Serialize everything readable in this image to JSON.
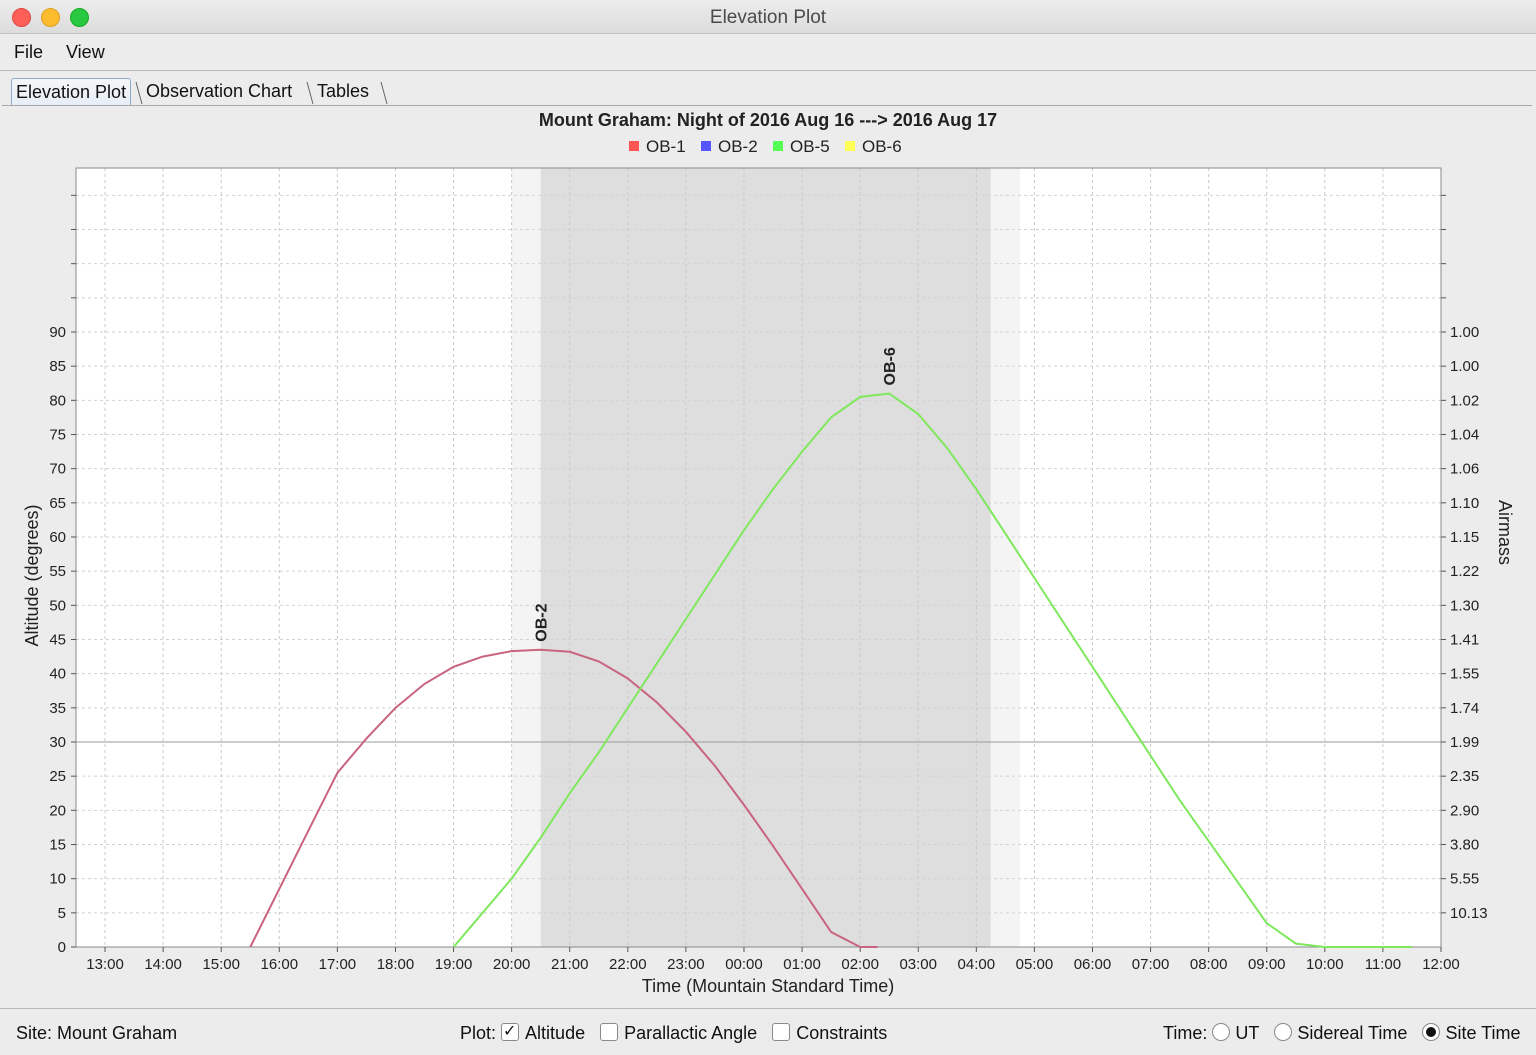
{
  "window": {
    "title": "Elevation Plot",
    "close_color": "#fc5f57",
    "minimize_color": "#fdbc2e",
    "maximize_color": "#28c840"
  },
  "menu": {
    "file": "File",
    "view": "View"
  },
  "tabs": [
    {
      "label": "Elevation Plot",
      "active": true
    },
    {
      "label": "Observation Chart",
      "active": false
    },
    {
      "label": "Tables",
      "active": false
    }
  ],
  "status": {
    "site": "Site: Mount Graham",
    "plot_label": "Plot:",
    "altitude": "Altitude",
    "altitude_checked": true,
    "parallactic": "Parallactic Angle",
    "parallactic_checked": false,
    "constraints": "Constraints",
    "constraints_checked": false,
    "time_label": "Time:",
    "ut": "UT",
    "sidereal": "Sidereal Time",
    "site_time": "Site Time",
    "selected_time": "Site Time"
  },
  "chart_data": {
    "type": "line",
    "title": "Mount Graham: Night of 2016 Aug 16 ---> 2016 Aug 17",
    "xlabel": "Time (Mountain Standard Time)",
    "ylabel": "Altitude (degrees)",
    "y2label": "Airmass",
    "x_ticks": [
      "13:00",
      "14:00",
      "15:00",
      "16:00",
      "17:00",
      "18:00",
      "19:00",
      "20:00",
      "21:00",
      "22:00",
      "23:00",
      "00:00",
      "01:00",
      "02:00",
      "03:00",
      "04:00",
      "05:00",
      "06:00",
      "07:00",
      "08:00",
      "09:00",
      "10:00",
      "11:00",
      "12:00"
    ],
    "x_range_hours": [
      12.5,
      36.0
    ],
    "ylim": [
      0,
      114
    ],
    "y_ticks": [
      0,
      5,
      10,
      15,
      20,
      25,
      30,
      35,
      40,
      45,
      50,
      55,
      60,
      65,
      70,
      75,
      80,
      85,
      90
    ],
    "airmass_ticks": [
      "10.13",
      "5.55",
      "3.80",
      "2.90",
      "2.35",
      "1.99",
      "1.74",
      "1.55",
      "1.41",
      "1.30",
      "1.22",
      "1.15",
      "1.10",
      "1.06",
      "1.04",
      "1.02",
      "1.00",
      "1.00"
    ],
    "reference_line": 30,
    "twilight_bands": [
      {
        "start": 20.0,
        "end": 20.5,
        "color": "#f4f4f4"
      },
      {
        "start": 20.5,
        "end": 28.25,
        "color": "#dedede"
      },
      {
        "start": 28.25,
        "end": 28.75,
        "color": "#f4f4f4"
      }
    ],
    "legend": [
      {
        "name": "OB-1",
        "color": "#ff5555"
      },
      {
        "name": "OB-2",
        "color": "#5555ff"
      },
      {
        "name": "OB-5",
        "color": "#55ff55"
      },
      {
        "name": "OB-6",
        "color": "#ffff55"
      }
    ],
    "series": [
      {
        "name": "OB-2",
        "color": "#c9647f",
        "label": "OB-2",
        "x": [
          15.5,
          16.0,
          16.5,
          17.0,
          17.5,
          18.0,
          18.5,
          19.0,
          19.5,
          20.0,
          20.5,
          21.0,
          21.5,
          22.0,
          22.5,
          23.0,
          23.5,
          24.0,
          24.5,
          25.0,
          25.5,
          26.0,
          26.3
        ],
        "y": [
          0,
          8.5,
          17,
          25.5,
          30.5,
          35,
          38.5,
          41,
          42.5,
          43.3,
          43.5,
          43.2,
          41.8,
          39.3,
          35.8,
          31.5,
          26.5,
          20.8,
          14.8,
          8.5,
          2.2,
          0,
          0
        ]
      },
      {
        "name": "OB-6",
        "color": "#7fe85c",
        "label": "OB-6",
        "x": [
          19.0,
          19.5,
          20.0,
          20.5,
          21.0,
          21.5,
          22.0,
          22.5,
          23.0,
          23.5,
          24.0,
          24.5,
          25.0,
          25.5,
          26.0,
          26.5,
          27.0,
          27.5,
          28.0,
          28.5,
          29.0,
          29.5,
          30.0,
          30.5,
          31.0,
          31.5,
          32.0,
          32.5,
          33.0,
          33.5,
          34.0,
          34.5,
          35.0,
          35.5
        ],
        "y": [
          0,
          5,
          10,
          16,
          22.5,
          28.5,
          35,
          41.5,
          48,
          54.5,
          61,
          67,
          72.5,
          77.5,
          80.5,
          81,
          78,
          73,
          67,
          60.5,
          54,
          47.5,
          41,
          34.5,
          28,
          21.5,
          15.5,
          9.5,
          3.5,
          0.5,
          0,
          0,
          0,
          0
        ]
      }
    ]
  }
}
